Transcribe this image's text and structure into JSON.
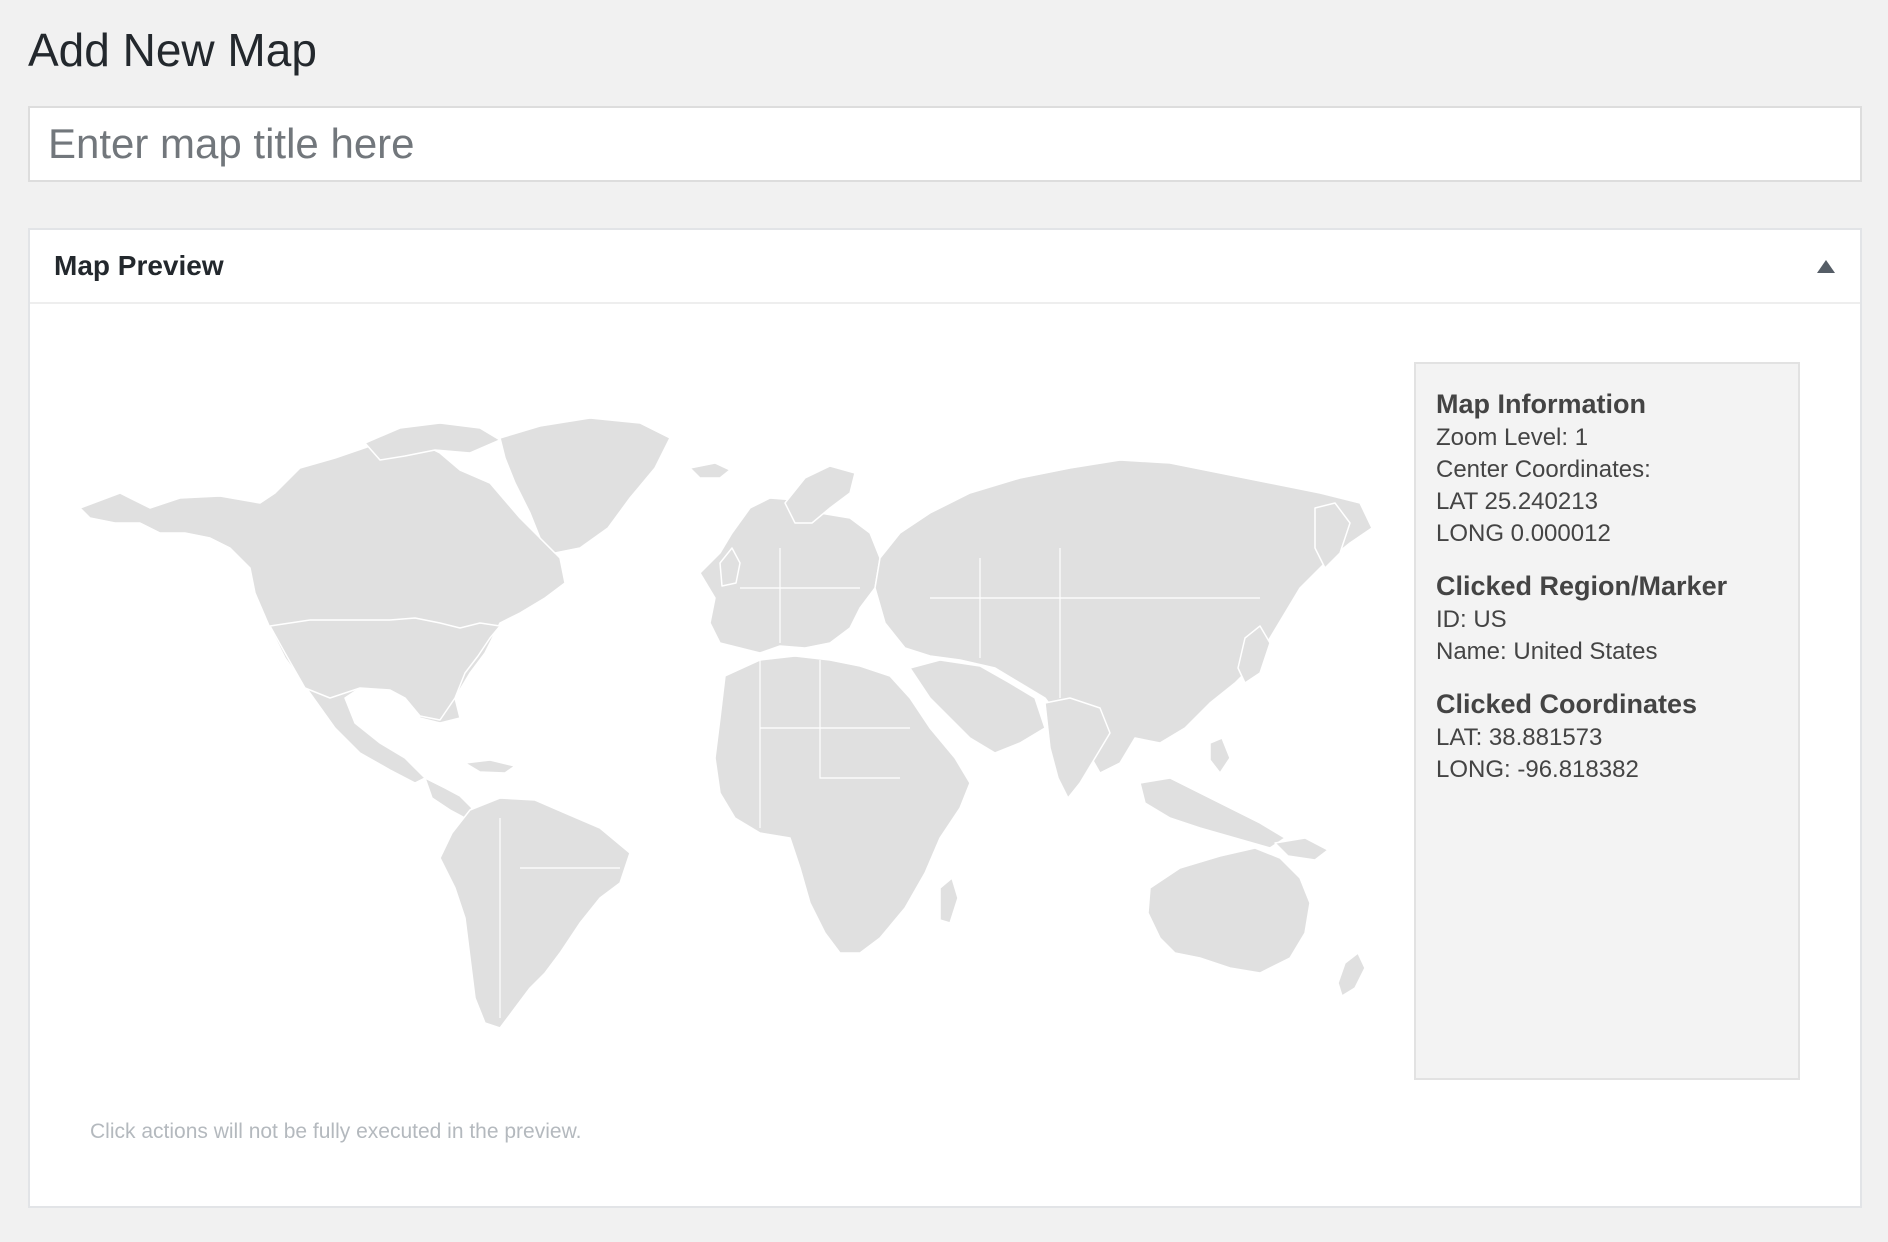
{
  "page": {
    "title": "Add New Map"
  },
  "title_input": {
    "placeholder": "Enter map title here",
    "value": ""
  },
  "map_preview": {
    "title": "Map Preview",
    "footer_note": "Click actions will not be fully executed in the preview."
  },
  "map_info": {
    "heading": "Map Information",
    "zoom_level": "Zoom Level: 1",
    "center_label": "Center Coordinates:",
    "center_lat": "LAT 25.240213",
    "center_long": "LONG 0.000012",
    "clicked_heading": "Clicked Region/Marker",
    "clicked_id": "ID: US",
    "clicked_name": "Name: United States",
    "coords_heading": "Clicked Coordinates",
    "coords_lat": "LAT: 38.881573",
    "coords_long": "LONG: -96.818382"
  },
  "colors": {
    "land": "#e0e0e0",
    "borders": "#ffffff",
    "background": "#f1f1f1"
  },
  "icons": {
    "toggle": "triangle-up-icon"
  }
}
